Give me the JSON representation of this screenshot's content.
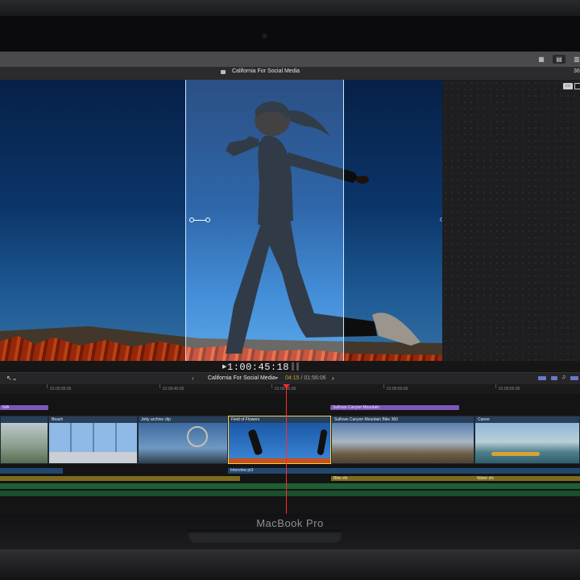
{
  "app": {
    "project_title": "California For Social Media",
    "zoom_readout": "36"
  },
  "viewer": {
    "timecode": "1:00:45:18"
  },
  "timeline": {
    "title": "California For Social Media",
    "duration_current": "04:15",
    "duration_separator": " / ",
    "duration_total": "01:56:06",
    "ruler_ticks": [
      "01:00:35:00",
      "01:00:40:00",
      "01:00:45:00",
      "01:00:50:00",
      "01:00:55:00"
    ],
    "connected_clips": [
      {
        "label": "NIA"
      },
      {
        "label": "Sullivan Canyon Mountain"
      }
    ],
    "clips": [
      {
        "label": ""
      },
      {
        "label": "Beach"
      },
      {
        "label": "Jetty archive clip"
      },
      {
        "label": "Field of Flowers"
      },
      {
        "label": "Sullivan Canyon Mountain Bike 360"
      },
      {
        "label": "Canoe"
      }
    ],
    "title_clip": "Interview pt3",
    "audio": [
      {
        "label": "Bike sfx"
      },
      {
        "label": "Water sfx"
      }
    ]
  },
  "device": {
    "brand": "MacBook Pro"
  }
}
